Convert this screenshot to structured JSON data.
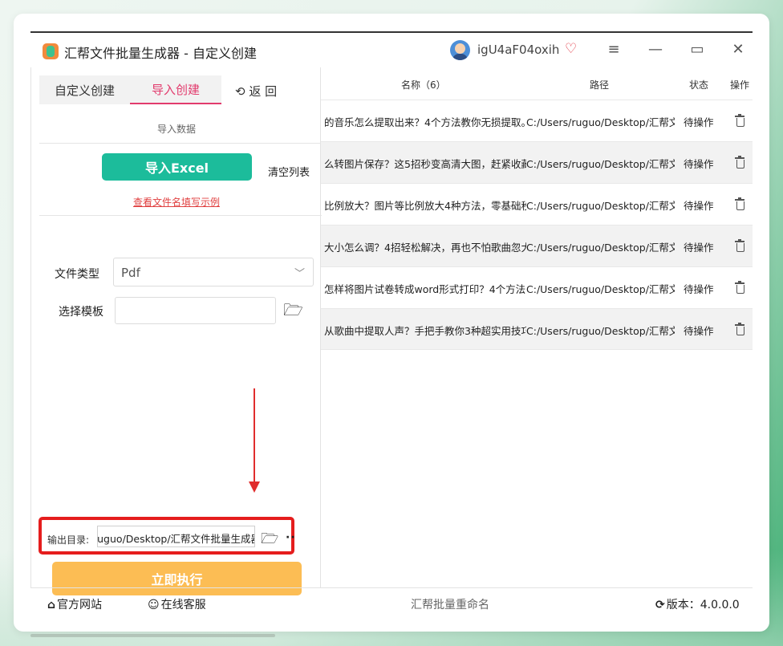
{
  "window": {
    "title": "汇帮文件批量生成器 - 自定义创建",
    "username": "igU4aF04oxih",
    "controls": {
      "menu": "≡",
      "minimize": "—",
      "maximize": "▭",
      "close": "✕"
    }
  },
  "left_panel": {
    "tabs": [
      {
        "label": "自定义创建",
        "active": false
      },
      {
        "label": "导入创建",
        "active": true
      }
    ],
    "back_label": "返  回",
    "section_label": "导入数据",
    "import_button": "导入Excel",
    "clear_button": "清空列表",
    "example_link": "查看文件名填写示例",
    "file_type": {
      "label": "文件类型",
      "value": "Pdf"
    },
    "template": {
      "label": "选择模板",
      "value": ""
    },
    "output": {
      "label": "输出目录:",
      "value": "ruguo/Desktop/汇帮文件批量生成器"
    },
    "run_button": "立即执行"
  },
  "table": {
    "headers": {
      "name": "名称（6）",
      "path": "路径",
      "status": "状态",
      "action": "操作"
    },
    "rows": [
      {
        "name": "的音乐怎么提取出来？4个方法教你无损提取。",
        "path": "C:/Users/ruguo/Desktop/汇帮文",
        "status": "待操作"
      },
      {
        "name": "么转图片保存？这5招秒变高清大图，赶紧收藏",
        "path": "C:/Users/ruguo/Desktop/汇帮文",
        "status": "待操作"
      },
      {
        "name": "比例放大？图片等比例放大4种方法，零基础秒",
        "path": "C:/Users/ruguo/Desktop/汇帮文",
        "status": "待操作"
      },
      {
        "name": "大小怎么调？4招轻松解决，再也不怕歌曲忽大",
        "path": "C:/Users/ruguo/Desktop/汇帮文",
        "status": "待操作"
      },
      {
        "name": " 怎样将图片试卷转成word形式打印？4个方法",
        "path": "C:/Users/ruguo/Desktop/汇帮文",
        "status": "待操作"
      },
      {
        "name": "从歌曲中提取人声？手把手教你3种超实用技巧",
        "path": "C:/Users/ruguo/Desktop/汇帮文",
        "status": "待操作"
      }
    ]
  },
  "footer": {
    "website": "官方网站",
    "support": "在线客服",
    "product": "汇帮批量重命名",
    "version_label": "版本：",
    "version": "4.0.0.0"
  },
  "colors": {
    "accent_pink": "#e23b6d",
    "import_green": "#1cbc9b",
    "run_orange": "#fcbd54",
    "highlight_red": "#e51d1d"
  }
}
